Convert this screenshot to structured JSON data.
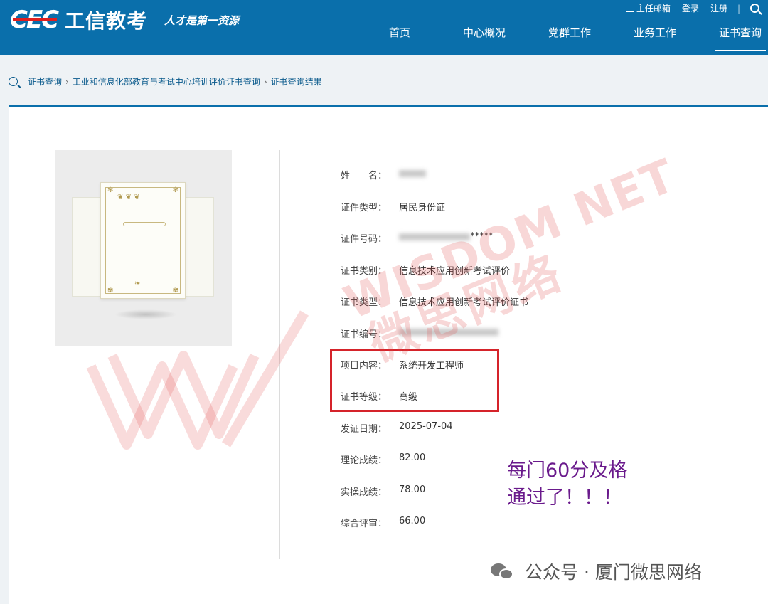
{
  "header": {
    "logo_mark": "CEC",
    "logo_text": "工信教考",
    "slogan": "人才是第一资源",
    "top_links": {
      "mail": "主任邮箱",
      "login": "登录",
      "register": "注册"
    },
    "nav": [
      "首页",
      "中心概况",
      "党群工作",
      "业务工作",
      "证书查询"
    ],
    "active_nav": "证书查询"
  },
  "breadcrumb": [
    "证书查询",
    "工业和信息化部教育与考试中心培训评价证书查询",
    "证书查询结果"
  ],
  "result": {
    "name": {
      "label": "姓　　名：",
      "value": ""
    },
    "id_type": {
      "label": "证件类型：",
      "value": "居民身份证"
    },
    "id_number": {
      "label": "证件号码：",
      "value": "*****"
    },
    "cert_category": {
      "label": "证书类别：",
      "value": "信息技术应用创新考试评价"
    },
    "cert_type": {
      "label": "证书类型：",
      "value": "信息技术应用创新考试评价证书"
    },
    "cert_number": {
      "label": "证书编号：",
      "value": ""
    },
    "project": {
      "label": "项目内容：",
      "value": "系统开发工程师"
    },
    "level": {
      "label": "证书等级：",
      "value": "高级"
    },
    "issue_date": {
      "label": "发证日期：",
      "value": "2025-07-04"
    },
    "theory_score": {
      "label": "理论成绩：",
      "value": "82.00"
    },
    "practice_score": {
      "label": "实操成绩：",
      "value": "78.00"
    },
    "overall_review": {
      "label": "综合评审：",
      "value": "66.00"
    }
  },
  "annotation": {
    "line1": "每门60分及格",
    "line2": "通过了！！！"
  },
  "watermark": {
    "en": "WISDOM NET",
    "cn": "微思网络"
  },
  "footer": {
    "text": "公众号 · 厦门微思网络"
  },
  "colors": {
    "header_bg": "#0a6fab",
    "highlight": "#d5232a",
    "annotation": "#6a1a8c"
  }
}
